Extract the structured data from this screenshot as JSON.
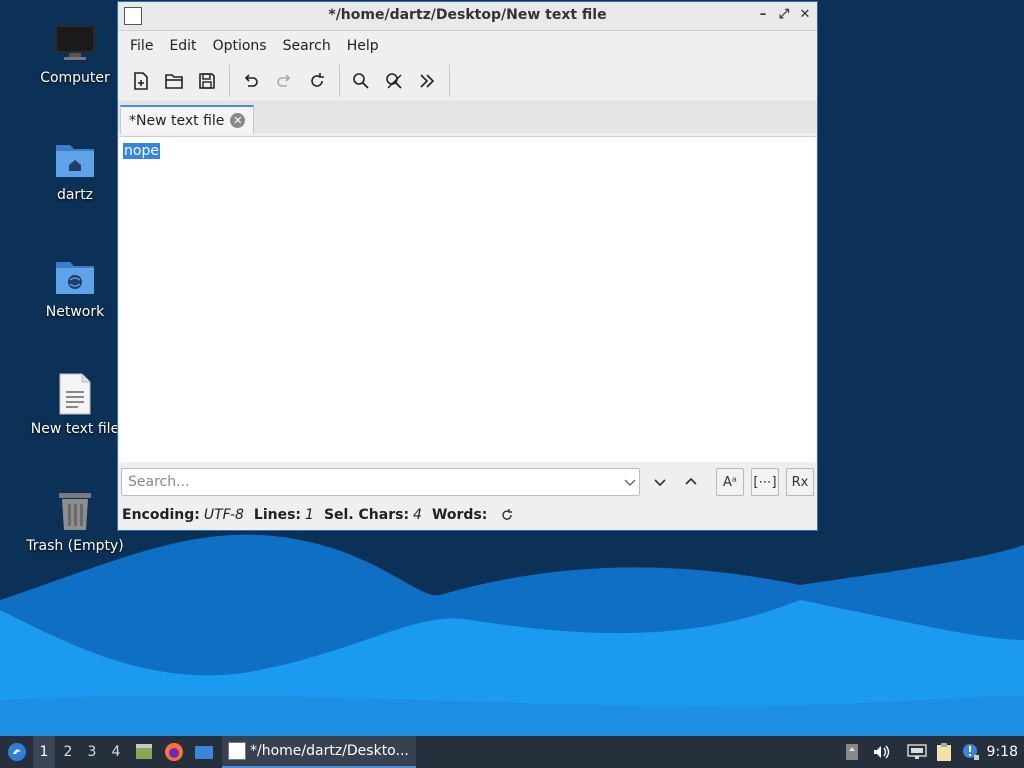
{
  "desktop": {
    "icons": [
      {
        "label": "Computer",
        "icon": "computer-icon"
      },
      {
        "label": "dartz",
        "icon": "home-folder-icon"
      },
      {
        "label": "Network",
        "icon": "network-folder-icon"
      },
      {
        "label": "New text file",
        "icon": "text-file-icon"
      },
      {
        "label": "Trash (Empty)",
        "icon": "trash-icon"
      }
    ]
  },
  "window": {
    "title": "*/home/dartz/Desktop/New text file",
    "menu": [
      "File",
      "Edit",
      "Options",
      "Search",
      "Help"
    ],
    "toolbar": [
      "new-file-icon",
      "open-folder-icon",
      "save-icon",
      "undo-icon",
      "redo-icon",
      "reload-icon",
      "find-icon",
      "find-replace-icon",
      "more-icon"
    ],
    "tab": {
      "label": "*New text file"
    },
    "editor": {
      "text": "nope"
    },
    "search": {
      "placeholder": "Search..."
    },
    "search_buttons": {
      "match_case": "Aᵃ",
      "whole_word": "[⋯]",
      "regex": "Rx"
    },
    "status": {
      "encoding_label": "Encoding:",
      "encoding_value": "UTF-8",
      "lines_label": "Lines:",
      "lines_value": "1",
      "sel_label": "Sel. Chars:",
      "sel_value": "4",
      "words_label": "Words:"
    }
  },
  "taskbar": {
    "workspaces": [
      "1",
      "2",
      "3",
      "4"
    ],
    "active_workspace": "1",
    "task_label": "*/home/dartz/Deskto...",
    "clock": "9:18"
  },
  "colors": {
    "accent": "#3584e4",
    "desktop_dark": "#0a2e52",
    "wave_light": "#1a9bf0",
    "taskbar": "#25303c"
  }
}
